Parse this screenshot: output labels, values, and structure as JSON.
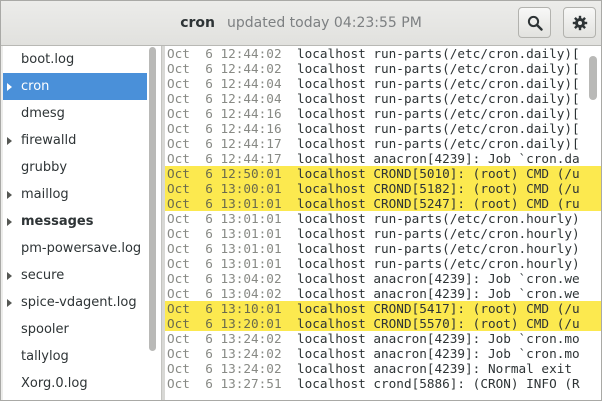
{
  "header": {
    "title": "cron",
    "subtitle": "updated today 04:23:55 PM",
    "search_icon": "search-icon",
    "settings_icon": "gear-icon"
  },
  "sidebar": {
    "items": [
      {
        "label": "boot.log",
        "expandable": false,
        "selected": false,
        "bold": false
      },
      {
        "label": "cron",
        "expandable": true,
        "selected": true,
        "bold": false
      },
      {
        "label": "dmesg",
        "expandable": false,
        "selected": false,
        "bold": false
      },
      {
        "label": "firewalld",
        "expandable": true,
        "selected": false,
        "bold": false
      },
      {
        "label": "grubby",
        "expandable": false,
        "selected": false,
        "bold": false
      },
      {
        "label": "maillog",
        "expandable": true,
        "selected": false,
        "bold": false
      },
      {
        "label": "messages",
        "expandable": true,
        "selected": false,
        "bold": true
      },
      {
        "label": "pm-powersave.log",
        "expandable": false,
        "selected": false,
        "bold": false
      },
      {
        "label": "secure",
        "expandable": true,
        "selected": false,
        "bold": false
      },
      {
        "label": "spice-vdagent.log",
        "expandable": true,
        "selected": false,
        "bold": false
      },
      {
        "label": "spooler",
        "expandable": false,
        "selected": false,
        "bold": false
      },
      {
        "label": "tallylog",
        "expandable": false,
        "selected": false,
        "bold": false
      },
      {
        "label": "Xorg.0.log",
        "expandable": false,
        "selected": false,
        "bold": false
      }
    ]
  },
  "log": {
    "lines": [
      {
        "ts": "Oct  6 12:44:02",
        "msg": "localhost run-parts(/etc/cron.daily)[",
        "hl": false
      },
      {
        "ts": "Oct  6 12:44:02",
        "msg": "localhost run-parts(/etc/cron.daily)[",
        "hl": false
      },
      {
        "ts": "Oct  6 12:44:04",
        "msg": "localhost run-parts(/etc/cron.daily)[",
        "hl": false
      },
      {
        "ts": "Oct  6 12:44:04",
        "msg": "localhost run-parts(/etc/cron.daily)[",
        "hl": false
      },
      {
        "ts": "Oct  6 12:44:16",
        "msg": "localhost run-parts(/etc/cron.daily)[",
        "hl": false
      },
      {
        "ts": "Oct  6 12:44:16",
        "msg": "localhost run-parts(/etc/cron.daily)[",
        "hl": false
      },
      {
        "ts": "Oct  6 12:44:17",
        "msg": "localhost run-parts(/etc/cron.daily)[",
        "hl": false
      },
      {
        "ts": "Oct  6 12:44:17",
        "msg": "localhost anacron[4239]: Job `cron.da",
        "hl": false
      },
      {
        "ts": "Oct  6 12:50:01",
        "msg": "localhost CROND[5010]: (root) CMD (/u",
        "hl": true
      },
      {
        "ts": "Oct  6 13:00:01",
        "msg": "localhost CROND[5182]: (root) CMD (/u",
        "hl": true
      },
      {
        "ts": "Oct  6 13:01:01",
        "msg": "localhost CROND[5247]: (root) CMD (ru",
        "hl": true
      },
      {
        "ts": "Oct  6 13:01:01",
        "msg": "localhost run-parts(/etc/cron.hourly)",
        "hl": false
      },
      {
        "ts": "Oct  6 13:01:01",
        "msg": "localhost run-parts(/etc/cron.hourly)",
        "hl": false
      },
      {
        "ts": "Oct  6 13:01:01",
        "msg": "localhost run-parts(/etc/cron.hourly)",
        "hl": false
      },
      {
        "ts": "Oct  6 13:01:01",
        "msg": "localhost run-parts(/etc/cron.hourly)",
        "hl": false
      },
      {
        "ts": "Oct  6 13:04:02",
        "msg": "localhost anacron[4239]: Job `cron.we",
        "hl": false
      },
      {
        "ts": "Oct  6 13:04:02",
        "msg": "localhost anacron[4239]: Job `cron.we",
        "hl": false
      },
      {
        "ts": "Oct  6 13:10:01",
        "msg": "localhost CROND[5417]: (root) CMD (/u",
        "hl": true
      },
      {
        "ts": "Oct  6 13:20:01",
        "msg": "localhost CROND[5570]: (root) CMD (/u",
        "hl": true
      },
      {
        "ts": "Oct  6 13:24:02",
        "msg": "localhost anacron[4239]: Job `cron.mo",
        "hl": false
      },
      {
        "ts": "Oct  6 13:24:02",
        "msg": "localhost anacron[4239]: Job `cron.mo",
        "hl": false
      },
      {
        "ts": "Oct  6 13:24:02",
        "msg": "localhost anacron[4239]: Normal exit",
        "hl": false
      },
      {
        "ts": "Oct  6 13:27:51",
        "msg": "localhost crond[5886]: (CRON) INFO (R",
        "hl": false
      }
    ]
  },
  "colors": {
    "selection": "#4a90d9",
    "highlight": "#fce94f"
  }
}
